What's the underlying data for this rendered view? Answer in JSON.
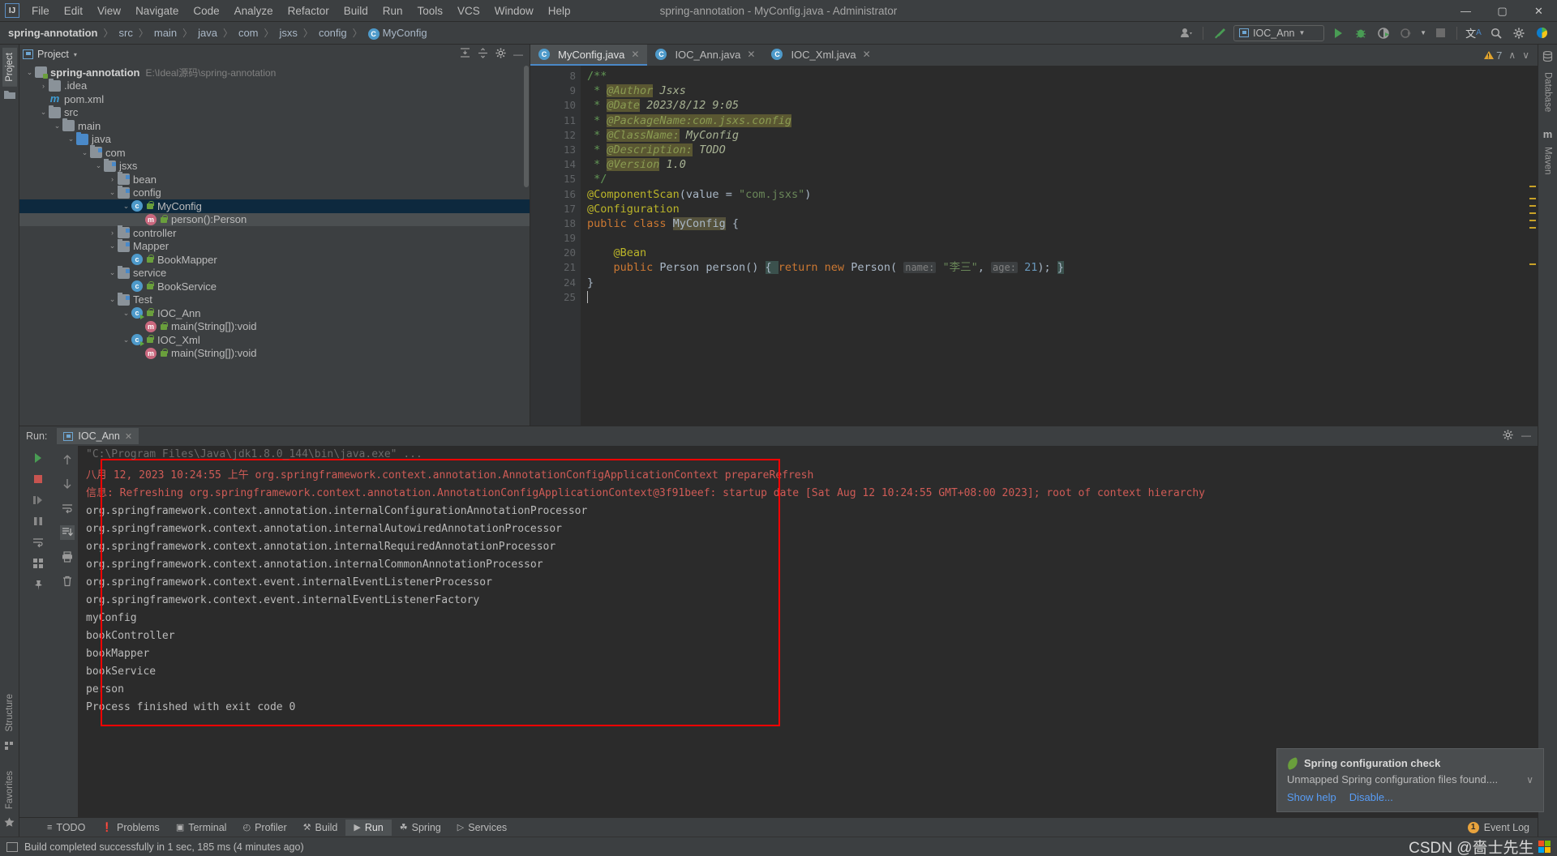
{
  "window": {
    "title": "spring-annotation - MyConfig.java - Administrator",
    "logo": "IJ",
    "minimize": "—",
    "maximize": "▢",
    "close": "✕"
  },
  "menubar": [
    {
      "label": "File"
    },
    {
      "label": "Edit"
    },
    {
      "label": "View"
    },
    {
      "label": "Navigate"
    },
    {
      "label": "Code"
    },
    {
      "label": "Analyze"
    },
    {
      "label": "Refactor"
    },
    {
      "label": "Build"
    },
    {
      "label": "Run"
    },
    {
      "label": "Tools"
    },
    {
      "label": "VCS"
    },
    {
      "label": "Window"
    },
    {
      "label": "Help"
    }
  ],
  "breadcrumb": {
    "items": [
      "spring-annotation",
      "src",
      "main",
      "java",
      "com",
      "jsxs",
      "config"
    ],
    "separator": "〉",
    "last": "MyConfig",
    "last_icon": "C"
  },
  "toolbar": {
    "run_config": "IOC_Ann",
    "icons": [
      {
        "name": "user-settings-icon",
        "glyph": "👤"
      },
      {
        "name": "build-hammer-icon",
        "glyph": "⚒"
      },
      {
        "name": "run-icon",
        "glyph": "▶"
      },
      {
        "name": "debug-icon",
        "glyph": "🐞"
      },
      {
        "name": "run-coverage-icon",
        "glyph": "◑"
      },
      {
        "name": "profile-icon",
        "glyph": "◴"
      },
      {
        "name": "stop-icon",
        "glyph": "■"
      },
      {
        "name": "translate-icon",
        "glyph": "文"
      },
      {
        "name": "search-everywhere-icon",
        "glyph": "🔍"
      },
      {
        "name": "settings-gear-icon",
        "glyph": "⚙"
      },
      {
        "name": "ide-feature-icon",
        "glyph": "◗"
      }
    ]
  },
  "left_rail": [
    {
      "label": "Project",
      "active": true
    },
    {
      "label": "Structure",
      "active": false
    },
    {
      "label": "Favorites",
      "active": false
    }
  ],
  "right_rail": [
    {
      "label": "Database"
    },
    {
      "label": "Maven"
    }
  ],
  "project_panel": {
    "title": "Project",
    "dropdown_caret": "▾",
    "tools": [
      "expand-all",
      "collapse-all",
      "settings",
      "hide"
    ],
    "tree": [
      {
        "depth": 0,
        "arrow": "⌄",
        "icon": "module",
        "label": "spring-annotation",
        "bold": true,
        "path": "E:\\Ideal源码\\spring-annotation"
      },
      {
        "depth": 1,
        "arrow": "›",
        "icon": "folder",
        "label": ".idea"
      },
      {
        "depth": 1,
        "arrow": "",
        "icon": "maven",
        "label": "pom.xml"
      },
      {
        "depth": 1,
        "arrow": "⌄",
        "icon": "folder",
        "label": "src"
      },
      {
        "depth": 2,
        "arrow": "⌄",
        "icon": "folder",
        "label": "main"
      },
      {
        "depth": 3,
        "arrow": "⌄",
        "icon": "src",
        "label": "java"
      },
      {
        "depth": 4,
        "arrow": "⌄",
        "icon": "pkg",
        "label": "com"
      },
      {
        "depth": 5,
        "arrow": "⌄",
        "icon": "pkg",
        "label": "jsxs"
      },
      {
        "depth": 6,
        "arrow": "›",
        "icon": "pkg",
        "label": "bean"
      },
      {
        "depth": 6,
        "arrow": "⌄",
        "icon": "pkg",
        "label": "config"
      },
      {
        "depth": 7,
        "arrow": "⌄",
        "icon": "cls",
        "label": "MyConfig",
        "selected": true,
        "lock": true
      },
      {
        "depth": 8,
        "arrow": "",
        "icon": "meth",
        "label": "person():Person",
        "lock": true,
        "selected2": true
      },
      {
        "depth": 6,
        "arrow": "›",
        "icon": "pkg",
        "label": "controller"
      },
      {
        "depth": 6,
        "arrow": "⌄",
        "icon": "pkg",
        "label": "Mapper"
      },
      {
        "depth": 7,
        "arrow": "",
        "icon": "cls",
        "label": "BookMapper",
        "lock": true
      },
      {
        "depth": 6,
        "arrow": "⌄",
        "icon": "pkg",
        "label": "service"
      },
      {
        "depth": 7,
        "arrow": "",
        "icon": "cls",
        "label": "BookService",
        "lock": true
      },
      {
        "depth": 6,
        "arrow": "⌄",
        "icon": "pkg",
        "label": "Test"
      },
      {
        "depth": 7,
        "arrow": "⌄",
        "icon": "clsrun",
        "label": "IOC_Ann",
        "lock": true
      },
      {
        "depth": 8,
        "arrow": "",
        "icon": "meth",
        "label": "main(String[]):void",
        "lock": true
      },
      {
        "depth": 7,
        "arrow": "⌄",
        "icon": "clsrun",
        "label": "IOC_Xml",
        "lock": true
      },
      {
        "depth": 8,
        "arrow": "",
        "icon": "meth",
        "label": "main(String[]):void",
        "lock": true
      }
    ]
  },
  "editor": {
    "tabs": [
      {
        "label": "MyConfig.java",
        "active": true,
        "close": "✕"
      },
      {
        "label": "IOC_Ann.java",
        "active": false,
        "close": "✕"
      },
      {
        "label": "IOC_Xml.java",
        "active": false,
        "close": "✕"
      }
    ],
    "warning_count": "7",
    "nav_up": "∧",
    "nav_down": "∨",
    "lines": [
      {
        "num": "8",
        "segments": [
          {
            "t": "/**",
            "c": "cmt"
          }
        ]
      },
      {
        "num": "9",
        "segments": [
          {
            "t": " * ",
            "c": "cmt"
          },
          {
            "t": "@Author",
            "c": "doc-tag"
          },
          {
            "t": " Jsxs",
            "c": "doc-txt"
          }
        ]
      },
      {
        "num": "10",
        "segments": [
          {
            "t": " * ",
            "c": "cmt"
          },
          {
            "t": "@Date",
            "c": "doc-tag"
          },
          {
            "t": " 2023/8/12 9:05",
            "c": "doc-txt"
          }
        ]
      },
      {
        "num": "11",
        "segments": [
          {
            "t": " * ",
            "c": "cmt"
          },
          {
            "t": "@PackageName:com.jsxs.config",
            "c": "doc-tag"
          }
        ]
      },
      {
        "num": "12",
        "segments": [
          {
            "t": " * ",
            "c": "cmt"
          },
          {
            "t": "@ClassName:",
            "c": "doc-tag"
          },
          {
            "t": " MyConfig",
            "c": "doc-txt"
          }
        ]
      },
      {
        "num": "13",
        "segments": [
          {
            "t": " * ",
            "c": "cmt"
          },
          {
            "t": "@Description:",
            "c": "doc-tag"
          },
          {
            "t": " TODO",
            "c": "doc-txt"
          }
        ]
      },
      {
        "num": "14",
        "segments": [
          {
            "t": " * ",
            "c": "cmt"
          },
          {
            "t": "@Version",
            "c": "doc-tag"
          },
          {
            "t": " 1.0",
            "c": "doc-txt"
          }
        ]
      },
      {
        "num": "15",
        "segments": [
          {
            "t": " */",
            "c": "cmt"
          }
        ]
      },
      {
        "num": "16",
        "gmark": "spring-bean",
        "segments": [
          {
            "t": "@ComponentScan",
            "c": "anno"
          },
          {
            "t": "(value = ",
            "c": "cls-name"
          },
          {
            "t": "\"com.jsxs\"",
            "c": "str"
          },
          {
            "t": ")",
            "c": "cls-name"
          }
        ]
      },
      {
        "num": "17",
        "segments": [
          {
            "t": "@Configuration",
            "c": "anno"
          }
        ]
      },
      {
        "num": "18",
        "gmark": "spring-config",
        "segments": [
          {
            "t": "public class ",
            "c": "kw"
          },
          {
            "t": "MyConfig",
            "c": "hl"
          },
          {
            "t": " {",
            "c": "cls-name"
          }
        ]
      },
      {
        "num": "19",
        "segments": []
      },
      {
        "num": "20",
        "gmark": "spring-bean",
        "segments": [
          {
            "t": "    @Bean",
            "c": "anno"
          }
        ]
      },
      {
        "num": "21",
        "segments": [
          {
            "t": "    ",
            "c": "cls-name"
          },
          {
            "t": "public ",
            "c": "kw"
          },
          {
            "t": "Person ",
            "c": "cls-name"
          },
          {
            "t": "person",
            "c": "cls-name"
          },
          {
            "t": "() ",
            "c": "cls-name"
          },
          {
            "t": "{ ",
            "c": "brace-hl"
          },
          {
            "t": "return ",
            "c": "kw"
          },
          {
            "t": "new ",
            "c": "kw"
          },
          {
            "t": "Person",
            "c": "cls-name"
          },
          {
            "t": "( ",
            "c": "cls-name"
          },
          {
            "t": "name:",
            "c": "hint"
          },
          {
            "t": " \"李三\"",
            "c": "str"
          },
          {
            "t": ", ",
            "c": "cls-name"
          },
          {
            "t": "age:",
            "c": "hint"
          },
          {
            "t": " ",
            "c": "cls-name"
          },
          {
            "t": "21",
            "c": "num"
          },
          {
            "t": "); ",
            "c": "cls-name"
          },
          {
            "t": "}",
            "c": "brace-hl"
          }
        ]
      },
      {
        "num": "24",
        "segments": [
          {
            "t": "}",
            "c": "cls-name"
          }
        ]
      },
      {
        "num": "25",
        "caret": true,
        "segments": []
      }
    ]
  },
  "run_panel": {
    "label": "Run:",
    "tab": "IOC_Ann",
    "tab_close": "✕",
    "side_icons": [
      "rerun",
      "stop",
      "resume",
      "pause",
      "up",
      "down",
      "soft-wrap",
      "scroll-to-end",
      "print",
      "trash",
      "grid",
      "pin"
    ],
    "console": [
      {
        "text": "\"C:\\Program Files\\Java\\jdk1.8.0_144\\bin\\java.exe\" ...",
        "cls": "top-clip"
      },
      {
        "text": "八月 12, 2023 10:24:55 上午 org.springframework.context.annotation.AnnotationConfigApplicationContext prepareRefresh",
        "cls": "err"
      },
      {
        "text": "信息: Refreshing org.springframework.context.annotation.AnnotationConfigApplicationContext@3f91beef: startup date [Sat Aug 12 10:24:55 GMT+08:00 2023]; root of context hierarchy",
        "cls": "err"
      },
      {
        "text": "org.springframework.context.annotation.internalConfigurationAnnotationProcessor",
        "cls": ""
      },
      {
        "text": "org.springframework.context.annotation.internalAutowiredAnnotationProcessor",
        "cls": ""
      },
      {
        "text": "org.springframework.context.annotation.internalRequiredAnnotationProcessor",
        "cls": ""
      },
      {
        "text": "org.springframework.context.annotation.internalCommonAnnotationProcessor",
        "cls": ""
      },
      {
        "text": "org.springframework.context.event.internalEventListenerProcessor",
        "cls": ""
      },
      {
        "text": "org.springframework.context.event.internalEventListenerFactory",
        "cls": ""
      },
      {
        "text": "myConfig",
        "cls": ""
      },
      {
        "text": "bookController",
        "cls": ""
      },
      {
        "text": "bookMapper",
        "cls": ""
      },
      {
        "text": "bookService",
        "cls": ""
      },
      {
        "text": "person",
        "cls": ""
      },
      {
        "text": "",
        "cls": ""
      },
      {
        "text": "Process finished with exit code 0",
        "cls": ""
      }
    ]
  },
  "tool_windows": [
    {
      "label": "TODO",
      "icon": "≡",
      "active": false
    },
    {
      "label": "Problems",
      "icon": "❗",
      "active": false
    },
    {
      "label": "Terminal",
      "icon": "▣",
      "active": false
    },
    {
      "label": "Profiler",
      "icon": "◴",
      "active": false
    },
    {
      "label": "Build",
      "icon": "⚒",
      "active": false
    },
    {
      "label": "Run",
      "icon": "▶",
      "active": true
    },
    {
      "label": "Spring",
      "icon": "☘",
      "active": false
    },
    {
      "label": "Services",
      "icon": "▷",
      "active": false
    }
  ],
  "event_log": {
    "count": "1",
    "label": "Event Log"
  },
  "statusbar": {
    "message": "Build completed successfully in 1 sec, 185 ms (4 minutes ago)",
    "watermark": "CSDN @嗇士先生"
  },
  "notification": {
    "title": "Spring configuration check",
    "body": "Unmapped Spring configuration files found....",
    "chevron": "∨",
    "links": [
      {
        "label": "Show help"
      },
      {
        "label": "Disable..."
      }
    ]
  },
  "colors": {
    "accent": "#4a88c7",
    "bg": "#3c3f41",
    "editor_bg": "#2b2b2b",
    "error_text": "#cf5b56",
    "highlight_box": "#ff0000"
  }
}
